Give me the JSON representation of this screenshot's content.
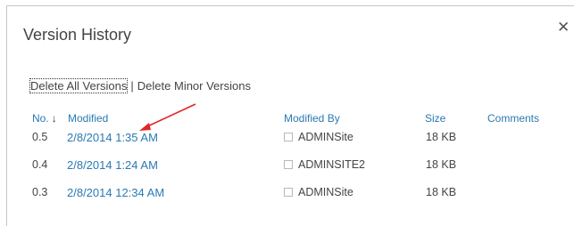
{
  "dialog": {
    "title": "Version History",
    "close_glyph": "✕"
  },
  "actions": {
    "delete_all": "Delete All Versions",
    "separator": "|",
    "delete_minor": "Delete Minor Versions"
  },
  "table": {
    "headers": {
      "no": "No.",
      "sort_arrow": "↓",
      "modified": "Modified",
      "modified_by": "Modified By",
      "size": "Size",
      "comments": "Comments"
    },
    "rows": [
      {
        "no": "0.5",
        "modified": "2/8/2014 1:35 AM",
        "modified_by": "ADMINSite",
        "size": "18 KB",
        "comments": ""
      },
      {
        "no": "0.4",
        "modified": "2/8/2014 1:24 AM",
        "modified_by": "ADMINSITE2",
        "size": "18 KB",
        "comments": ""
      },
      {
        "no": "0.3",
        "modified": "2/8/2014 12:34 AM",
        "modified_by": "ADMINSite",
        "size": "18 KB",
        "comments": ""
      }
    ]
  },
  "colors": {
    "link": "#2a7ab3",
    "text": "#444444",
    "annotation_arrow": "#e0262a",
    "border": "#c6c6c6"
  },
  "icons": {
    "close": "close-icon",
    "sort": "sort-descending-icon",
    "user_checkbox": "checkbox-icon",
    "annotation": "red-arrow-annotation"
  }
}
